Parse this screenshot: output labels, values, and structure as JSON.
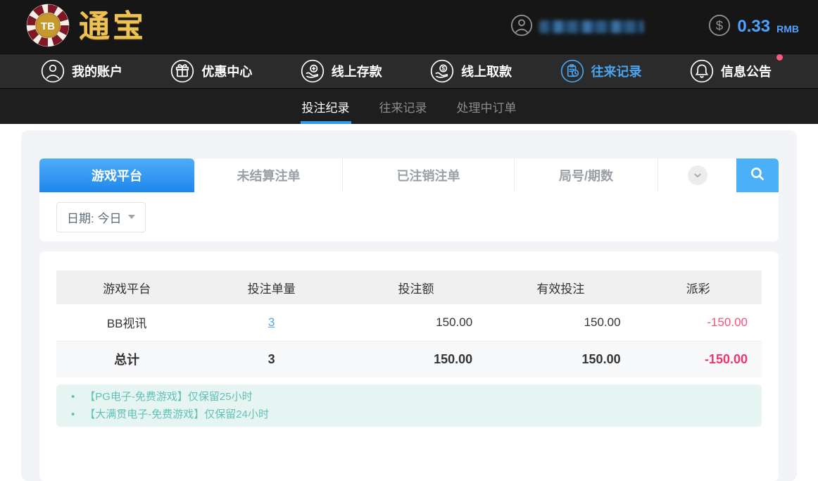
{
  "brand": {
    "badge": "TB",
    "name": "通宝"
  },
  "header": {
    "balance": "0.33",
    "currency": "RMB"
  },
  "nav": {
    "items": [
      {
        "label": "我的账户"
      },
      {
        "label": "优惠中心"
      },
      {
        "label": "线上存款"
      },
      {
        "label": "线上取款"
      },
      {
        "label": "往来记录"
      },
      {
        "label": "信息公告"
      }
    ],
    "active": "往来记录"
  },
  "subnav": {
    "items": [
      {
        "label": "投注纪录"
      },
      {
        "label": "往来记录"
      },
      {
        "label": "处理中订单"
      }
    ],
    "active": "投注纪录"
  },
  "tabs": {
    "items": [
      {
        "label": "游戏平台"
      },
      {
        "label": "未结算注单"
      },
      {
        "label": "已注销注单"
      },
      {
        "label": "局号/期数"
      }
    ],
    "active": "游戏平台"
  },
  "filter": {
    "date": "日期: 今日"
  },
  "table": {
    "headers": [
      "游戏平台",
      "投注单量",
      "投注额",
      "有效投注",
      "派彩"
    ],
    "rows": [
      {
        "platform": "BB视讯",
        "count": "3",
        "bet": "150.00",
        "valid": "150.00",
        "payout": "-150.00"
      }
    ],
    "total": {
      "label": "总计",
      "count": "3",
      "bet": "150.00",
      "valid": "150.00",
      "payout": "-150.00"
    }
  },
  "notes": {
    "items": [
      {
        "text": "【PG电子-免费游戏】仅保留25小时"
      },
      {
        "text": "【大满贯电子-免费游戏】仅保留24小时"
      }
    ]
  },
  "colors": {
    "accent": "#2e9bf0",
    "negative": "#f4527e",
    "notes_text": "#62c1b6",
    "gold": "#ecc257"
  }
}
